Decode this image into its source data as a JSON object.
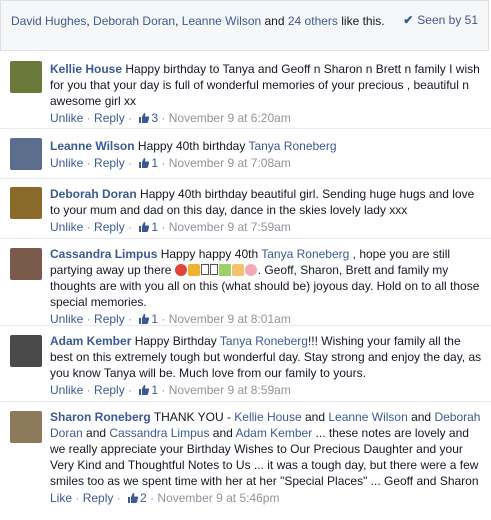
{
  "header": {
    "liker1": "David Hughes",
    "sep1": ", ",
    "liker2": "Deborah Doran",
    "sep2": ", ",
    "liker3": "Leanne Wilson",
    "and": " and ",
    "others": "24 others",
    "like_this": " like this.",
    "seen_label": "Seen by 51"
  },
  "comments": [
    {
      "author": "Kellie House",
      "text": "Happy birthday to Tanya and Geoff n Sharon n Brett n family I wish for you that your day is full of wonderful memories of your precious , beautiful n awesome girl xx",
      "action": "Unlike",
      "reply": "Reply",
      "likes": "3",
      "time": "November 9 at 6:20am",
      "avatar_color": "#6b7a3a"
    },
    {
      "author": "Leanne Wilson",
      "text": "Happy 40th birthday ",
      "mention": "Tanya Roneberg",
      "action": "Unlike",
      "reply": "Reply",
      "likes": "1",
      "time": "November 9 at 7:08am",
      "avatar_color": "#5c6e8c"
    },
    {
      "author": "Deborah Doran",
      "text": "Happy 40th birthday beautiful girl. Sending huge hugs and love to your mum and dad on this day, dance in the skies lovely lady xxx",
      "action": "Unlike",
      "reply": "Reply",
      "likes": "1",
      "time": "November 9 at 7:59am",
      "avatar_color": "#8a6a2a"
    },
    {
      "author": "Cassandra Limpus",
      "text1": "Happy happy 40th ",
      "mention": "Tanya Roneberg",
      "text2": " , hope you are still partying away up there ",
      "text3": ". Geoff, Sharon, Brett and family my thoughts are with you all on this (what should be) joyous day. Hold on to all those special memories.",
      "action": "Unlike",
      "reply": "Reply",
      "likes": "1",
      "time": "November 9 at 8:01am",
      "avatar_color": "#7a5a4a"
    },
    {
      "author": "Adam Kember",
      "text1": "Happy Birthday ",
      "mention": "Tanya Roneberg",
      "text2": "!!! Wishing your family all the best on this extremely tough but wonderful day. Stay strong and enjoy the day, as you know Tanya will be. Much love from our family to yours.",
      "action": "Unlike",
      "reply": "Reply",
      "likes": "1",
      "time": "November 9 at 8:59am",
      "avatar_color": "#4a4a4a"
    },
    {
      "author": "Sharon Roneberg",
      "text1": "THANK YOU - ",
      "m1": "Kellie House",
      "and1": " and ",
      "m2": "Leanne Wilson",
      "and2": " and ",
      "m3": "Deborah Doran",
      "and3": " and ",
      "m4": "Cassandra Limpus",
      "and4": " and ",
      "m5": "Adam Kember",
      "text2": " ... these notes are lovely and we really appreciate your Birthday Wishes to Our Precious Daughter and your Very Kind and Thoughtful Notes to Us ... it was a tough day, but there were a few smiles too as we spent time with her at her \"Special Places\" ... Geoff and Sharon",
      "action": "Like",
      "reply": "Reply",
      "likes": "2",
      "time": "November 9 at 5:46pm",
      "avatar_color": "#8c7a5a"
    }
  ],
  "sep": " · "
}
